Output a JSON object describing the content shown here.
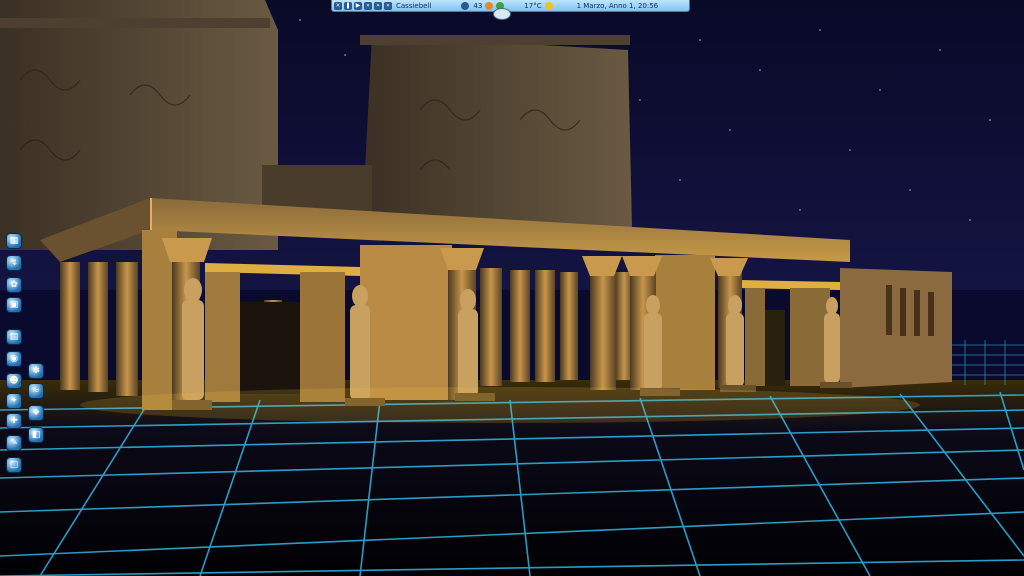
{
  "status_bar": {
    "park_name": "Cassiebell",
    "guest_count": "43",
    "temperature": "17°C",
    "date": "1 Marzo, Anno 1, 20:56",
    "buttons": [
      "close-icon",
      "pause-icon",
      "play-icon",
      "fast-forward-icon",
      "faster-icon",
      "fastest-icon"
    ],
    "icons": [
      "guest-icon",
      "happiness-icon",
      "cash-icon",
      "sun-icon"
    ]
  },
  "left_toolbar": {
    "tools": [
      {
        "name": "terrain-tool",
        "glyph": "▦"
      },
      {
        "name": "path-tool",
        "glyph": "↯"
      },
      {
        "name": "scenery-tool",
        "glyph": "✿"
      },
      {
        "name": "demolish-tool",
        "glyph": "▣"
      },
      {
        "name": "rides-tool",
        "glyph": "▤"
      },
      {
        "name": "shops-tool",
        "glyph": "◉"
      },
      {
        "name": "staff-tool",
        "glyph": "☻"
      },
      {
        "name": "finance-tool",
        "glyph": "✦"
      },
      {
        "name": "research-tool",
        "glyph": "✚"
      },
      {
        "name": "settings-tool",
        "glyph": "✎"
      },
      {
        "name": "delete-tool",
        "glyph": "▢"
      },
      {
        "name": "weather-tool",
        "glyph": "✽"
      },
      {
        "name": "water-tool",
        "glyph": "≈"
      },
      {
        "name": "fireworks-tool",
        "glyph": "❖"
      },
      {
        "name": "camera-tool",
        "glyph": "◧"
      }
    ]
  },
  "colors": {
    "sky": "#0a0a2e",
    "grid": "#2fb8e6",
    "stone_lit": "#b88a3a",
    "stone_dark": "#3a2e1e",
    "glow": "#f5c040"
  }
}
